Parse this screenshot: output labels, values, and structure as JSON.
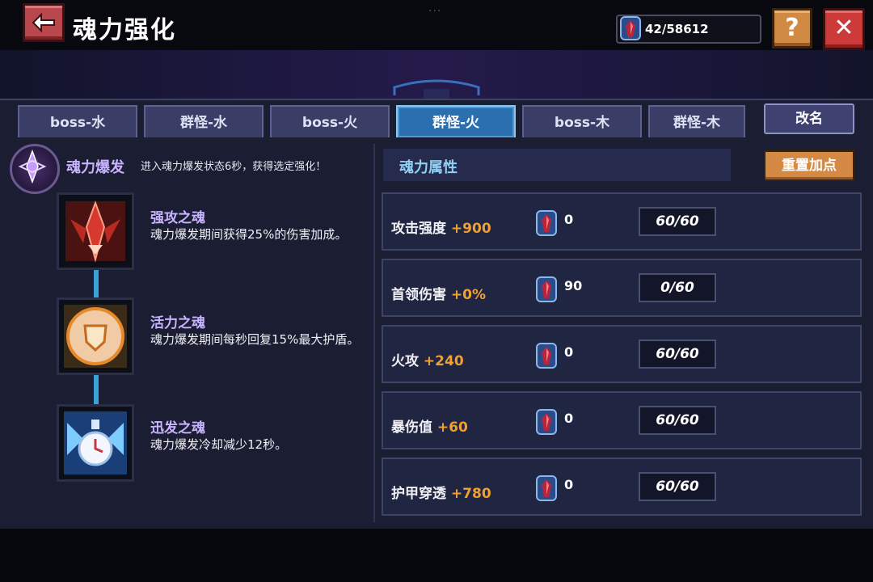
{
  "header": {
    "title": "魂力强化",
    "drag_handle": "···",
    "currency_amount": "42/58612",
    "help_label": "?",
    "close_label": "✕"
  },
  "tabs": [
    {
      "label": "boss-水",
      "active": false
    },
    {
      "label": "群怪-水",
      "active": false
    },
    {
      "label": "boss-火",
      "active": false
    },
    {
      "label": "群怪-火",
      "active": true
    },
    {
      "label": "boss-木",
      "active": false
    },
    {
      "label": "群怪-木",
      "active": false
    }
  ],
  "rename_label": "改名",
  "burst": {
    "title": "魂力爆发",
    "description": "进入魂力爆发状态6秒，获得选定强化！"
  },
  "souls": [
    {
      "name": "强攻之魂",
      "description": "魂力爆发期间获得25%的伤害加成。",
      "icon": "red-spiky-soul-icon"
    },
    {
      "name": "活力之魂",
      "description": "魂力爆发期间每秒回复15%最大护盾。",
      "icon": "golden-shield-soul-icon"
    },
    {
      "name": "迅发之魂",
      "description": "魂力爆发冷却减少12秒。",
      "icon": "blue-clock-soul-icon"
    }
  ],
  "attributes_header": "魂力属性",
  "reset_label": "重置加点",
  "attributes": [
    {
      "name": "攻击强度",
      "bonus": "+900",
      "cost": "0",
      "level": "60/60"
    },
    {
      "name": "首领伤害",
      "bonus": "+0%",
      "cost": "90",
      "level": "0/60"
    },
    {
      "name": "火攻",
      "bonus": "+240",
      "cost": "0",
      "level": "60/60"
    },
    {
      "name": "暴伤值",
      "bonus": "+60",
      "cost": "0",
      "level": "60/60"
    },
    {
      "name": "护甲穿透",
      "bonus": "+780",
      "cost": "0",
      "level": "60/60"
    }
  ],
  "colors": {
    "accent_purple": "#c9b3ff",
    "accent_blue": "#8fd1f4",
    "bonus_orange": "#f0a030",
    "active_tab": "#2c6fae"
  }
}
